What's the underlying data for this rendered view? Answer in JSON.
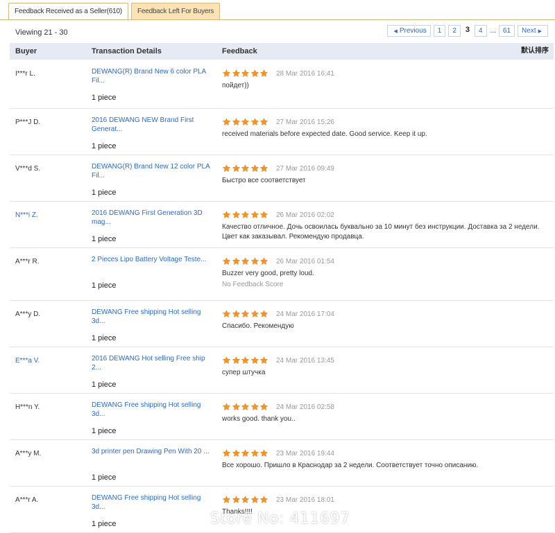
{
  "tabs": [
    {
      "label": "Feedback Received as a Seller(610)",
      "active": true
    },
    {
      "label": "Feedback Left For Buyers",
      "active": false
    }
  ],
  "viewing": "Viewing 21 - 30",
  "pager": {
    "previous": "Previous",
    "pages": [
      "1",
      "2",
      "3",
      "4"
    ],
    "current": "3",
    "ellipsis": "...",
    "last": "61",
    "next": "Next"
  },
  "columns": {
    "buyer": "Buyer",
    "transaction": "Transaction Details",
    "feedback": "Feedback",
    "sort": "默认排序"
  },
  "star_color": "#f7941d",
  "rows": [
    {
      "buyer": "I***r L.",
      "buyer_link": false,
      "product": "DEWANG(R) Brand New 6 color PLA Fil...",
      "qty": "1 piece",
      "date": "28 Mar 2016 16:41",
      "feedback": "пойдет))",
      "extra": "",
      "rating": 5
    },
    {
      "buyer": "P***J D.",
      "buyer_link": false,
      "product": "2016 DEWANG NEW Brand First Generat...",
      "qty": "1 piece",
      "date": "27 Mar 2016 15:26",
      "feedback": "received materials before expected date. Good service. Keep it up.",
      "extra": "",
      "rating": 5
    },
    {
      "buyer": "V***d S.",
      "buyer_link": false,
      "product": "DEWANG(R) Brand New 12 color PLA Fil...",
      "qty": "1 piece",
      "date": "27 Mar 2016 09:49",
      "feedback": "Быстро все соответствует",
      "extra": "",
      "rating": 5
    },
    {
      "buyer": "N***i Z.",
      "buyer_link": true,
      "product": "2016 DEWANG First Generation 3D mag...",
      "qty": "1 piece",
      "date": "26 Mar 2016 02:02",
      "feedback": "Качество отличное. Дочь освоилась буквально за 10 минут без инструкции. Доставка за 2 недели. Цвет как заказывал. Рекомендую продавца.",
      "extra": "",
      "rating": 5
    },
    {
      "buyer": "A***r R.",
      "buyer_link": false,
      "product": "2 Pieces Lipo Battery Voltage Teste...",
      "qty": "1 piece",
      "date": "26 Mar 2016 01:54",
      "feedback": "Buzzer very good, pretty loud.",
      "extra": "No Feedback Score",
      "rating": 5
    },
    {
      "buyer": "A***y D.",
      "buyer_link": false,
      "product": "DEWANG Free shipping Hot selling 3d...",
      "qty": "1 piece",
      "date": "24 Mar 2016 17:04",
      "feedback": "Спасибо. Рекомендую",
      "extra": "",
      "rating": 5
    },
    {
      "buyer": "E***a V.",
      "buyer_link": true,
      "product": "2016 DEWANG Hot selling Free ship 2...",
      "qty": "1 piece",
      "date": "24 Mar 2016 13:45",
      "feedback": "супер штучка",
      "extra": "",
      "rating": 5
    },
    {
      "buyer": "H***n Y.",
      "buyer_link": false,
      "product": "DEWANG Free shipping Hot selling 3d...",
      "qty": "1 piece",
      "date": "24 Mar 2016 02:58",
      "feedback": "works good. thank you..",
      "extra": "",
      "rating": 5
    },
    {
      "buyer": "A***y M.",
      "buyer_link": false,
      "product": "3d printer pen Drawing Pen With 20 ...",
      "qty": "1 piece",
      "date": "23 Mar 2016 19:44",
      "feedback": "Все хорошо. Пришло в Краснодар за 2 недели. Соответствует точно описанию.",
      "extra": "",
      "rating": 5
    },
    {
      "buyer": "A***r A.",
      "buyer_link": false,
      "product": "DEWANG Free shipping Hot selling 3d...",
      "qty": "1 piece",
      "date": "23 Mar 2016 18:01",
      "feedback": "Thanks!!!!",
      "extra": "",
      "rating": 5
    }
  ],
  "watermark": "Store No: 411697"
}
